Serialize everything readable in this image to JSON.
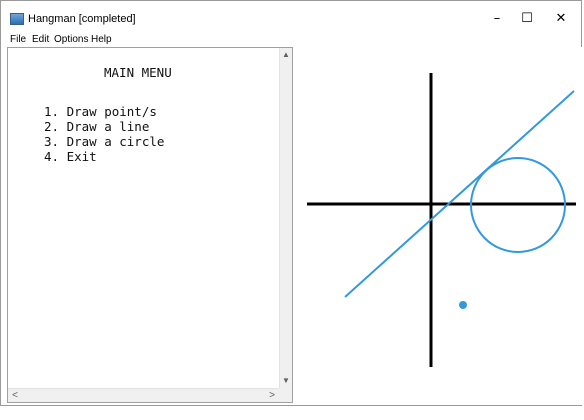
{
  "window": {
    "title": "Hangman [completed]",
    "icon": "java-app-icon",
    "controls": {
      "minimize": "–",
      "maximize": "☐",
      "close": "✕"
    }
  },
  "menubar": {
    "items": [
      "File",
      "Edit",
      "Options",
      "Help"
    ]
  },
  "text_pane": {
    "heading": "MAIN MENU",
    "options": [
      "1. Draw point/s",
      "2. Draw a line",
      "3. Draw a circle",
      "4. Exit"
    ],
    "scroll_up": "▲",
    "scroll_down": "▼",
    "scroll_left": "<",
    "scroll_right": ">"
  },
  "canvas": {
    "axis_color": "#000000",
    "shape_color": "#3399dd"
  }
}
